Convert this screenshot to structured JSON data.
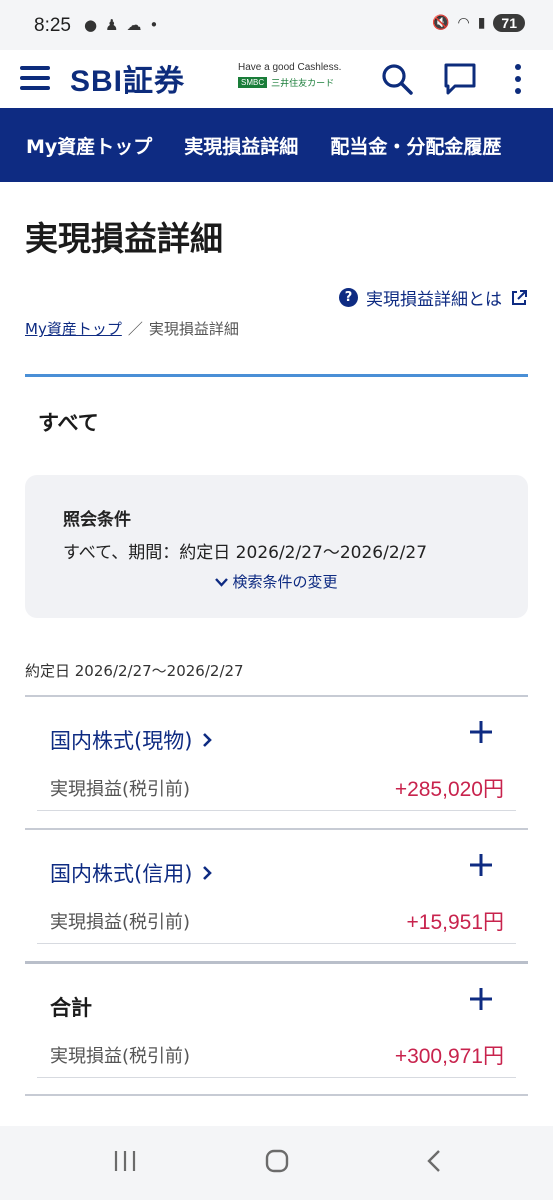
{
  "status_bar": {
    "time": "8:25",
    "battery": "71"
  },
  "header": {
    "logo": "SBI証券",
    "tagline": "Have a good Cashless.",
    "card_badge": "SMBC",
    "card_name": "三井住友カード"
  },
  "nav_tabs": [
    {
      "label": "My資産トップ"
    },
    {
      "label": "実現損益詳細"
    },
    {
      "label": "配当金・分配金履歴"
    }
  ],
  "page": {
    "title": "実現損益詳細",
    "help_link": "実現損益詳細とは",
    "breadcrumb": {
      "home": "My資産トップ",
      "separator": "／",
      "current": "実現損益詳細"
    },
    "filter_title": "すべて"
  },
  "conditions": {
    "label": "照会条件",
    "value": "すべて、期間：約定日 2026/2/27〜2026/2/27",
    "change_link": "検索条件の変更"
  },
  "date_range": "約定日 2026/2/27〜2026/2/27",
  "sections": [
    {
      "title": "国内株式(現物)",
      "row_label": "実現損益(税引前)",
      "row_value": "+285,020円"
    },
    {
      "title": "国内株式(信用)",
      "row_label": "実現損益(税引前)",
      "row_value": "+15,951円"
    },
    {
      "title": "合計",
      "row_label": "実現損益(税引前)",
      "row_value": "+300,971円"
    }
  ],
  "colors": {
    "brand_navy": "#0e2b82",
    "profit_red": "#c8234d",
    "accent_blue": "#4a8fd6"
  },
  "icons": [
    "hamburger-icon",
    "search-icon",
    "chat-icon",
    "more-vertical-icon",
    "help-icon",
    "external-link-icon",
    "chevron-down-icon",
    "chevron-right-icon",
    "plus-icon"
  ]
}
